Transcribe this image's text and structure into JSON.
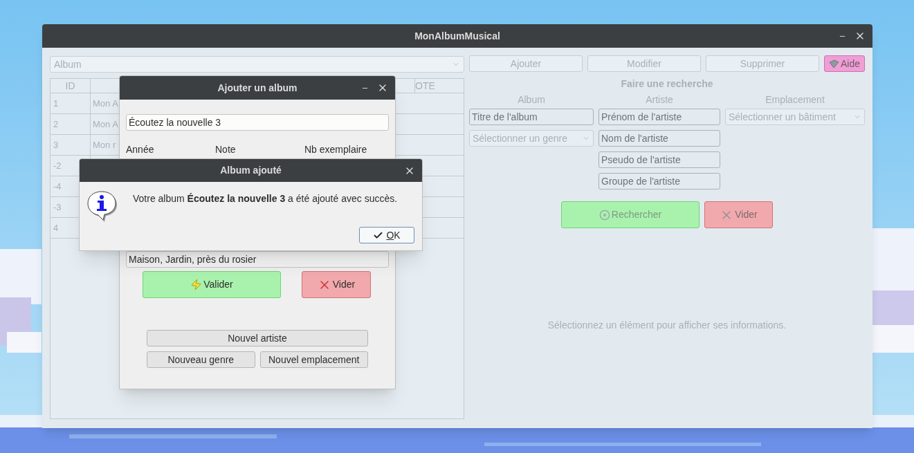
{
  "main_window": {
    "title": "MonAlbumMusical",
    "disabled": true,
    "album_filter": {
      "value": "Album"
    },
    "table": {
      "columns": [
        "ID",
        "OTE"
      ],
      "rows": [
        {
          "id": "1",
          "column_2": "Mon A"
        },
        {
          "id": "2",
          "column_2": "Mon A"
        },
        {
          "id": "3",
          "column_2": "Mon r"
        },
        {
          "id": "-2"
        },
        {
          "id": "-4"
        },
        {
          "id": "-3"
        },
        {
          "id": "4"
        }
      ]
    },
    "toolbar": [
      {
        "kind": "action",
        "label": "Ajouter"
      },
      {
        "kind": "action",
        "label": "Modifier"
      },
      {
        "kind": "action",
        "label": "Supprimer"
      },
      {
        "kind": "help",
        "label": "Aide"
      }
    ],
    "search": {
      "title": "Faire une recherche",
      "columns": [
        {
          "heading": "Album",
          "fields": [
            {
              "kind": "text",
              "placeholder": "Titre de l'album"
            },
            {
              "kind": "select",
              "placeholder": "Sélectionner un genre"
            }
          ]
        },
        {
          "heading": "Artiste",
          "fields": [
            {
              "kind": "text",
              "placeholder": "Prénom de l'artiste"
            },
            {
              "kind": "text",
              "placeholder": "Nom de l'artiste"
            },
            {
              "kind": "text",
              "placeholder": "Pseudo de l'artiste"
            },
            {
              "kind": "text",
              "placeholder": "Groupe de l'artiste"
            }
          ]
        },
        {
          "heading": "Emplacement",
          "fields": [
            {
              "kind": "select",
              "placeholder": "Sélectionner un bâtiment"
            }
          ]
        }
      ],
      "buttons": [
        {
          "kind": "search",
          "label": "Rechercher"
        },
        {
          "kind": "clear",
          "label": "Vider"
        }
      ]
    },
    "details_message": "Sélectionnez un élément pour afficher ses informations."
  },
  "add_album_dialog": {
    "title": "Ajouter un album",
    "title_field": {
      "value": "Écoutez la nouvelle 3"
    },
    "labels": [
      "Année",
      "Note",
      "Nb exemplaire"
    ],
    "location_field": {
      "value": "Maison, Jardin, près du rosier"
    },
    "buttons": [
      {
        "kind": "confirm",
        "label": "Valider"
      },
      {
        "kind": "clear",
        "label": "Vider"
      }
    ],
    "secondary_buttons": [
      "Nouvel artiste",
      "Nouveau genre",
      "Nouvel emplacement"
    ]
  },
  "message_dialog": {
    "title": "Album ajouté",
    "message": "Votre album **Écoutez la nouvelle 3** a été ajouté avec succès.",
    "ok_button": {
      "label": "OK"
    }
  }
}
